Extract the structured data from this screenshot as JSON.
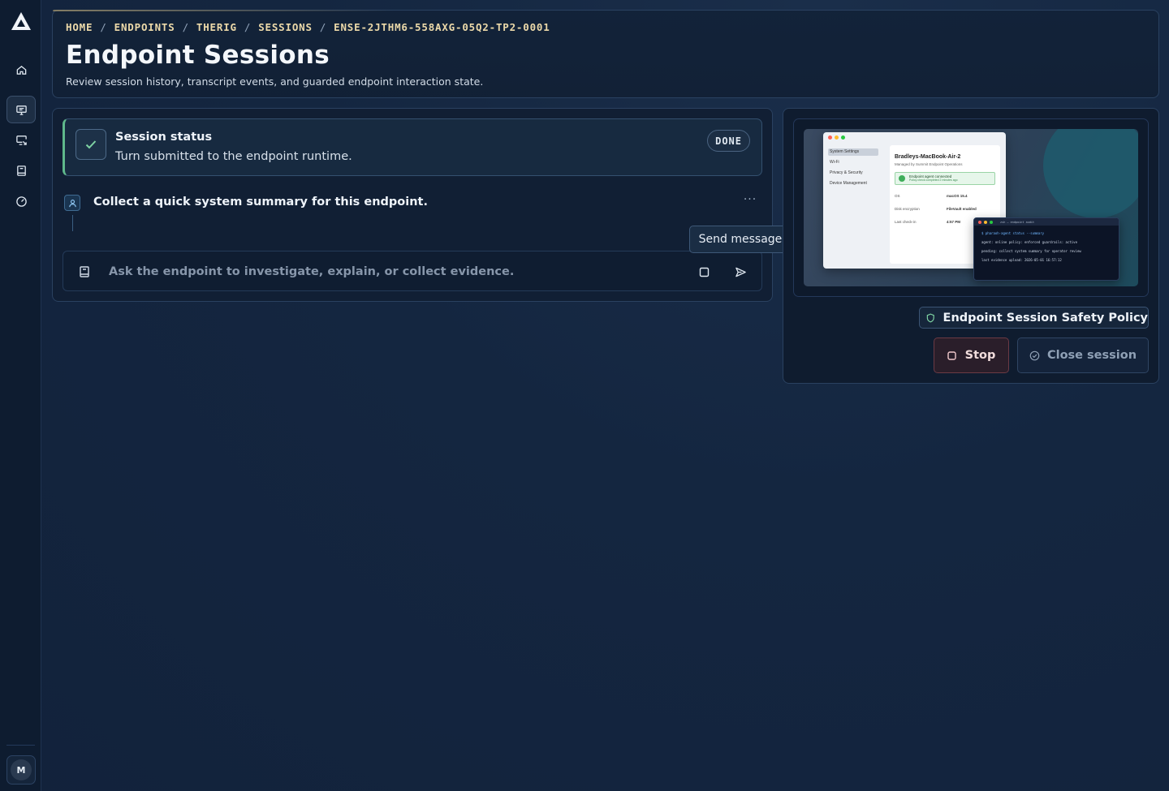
{
  "sidebar": {
    "logo": "triangle-logo",
    "items": [
      {
        "name": "home",
        "icon": "home-icon"
      },
      {
        "name": "endpoints",
        "icon": "monitor-icon",
        "active": true
      },
      {
        "name": "remote",
        "icon": "screen-share-icon"
      },
      {
        "name": "docs",
        "icon": "book-icon"
      },
      {
        "name": "dashboard",
        "icon": "gauge-icon"
      }
    ],
    "user_initial": "M"
  },
  "header": {
    "breadcrumb": [
      "HOME",
      "ENDPOINTS",
      "THERIG",
      "SESSIONS",
      "ENSE-2JTHM6-558AXG-05Q2-TP2-0001"
    ],
    "breadcrumb_separator": "/",
    "title": "Endpoint Sessions",
    "subtitle": "Review session history, transcript events, and guarded endpoint interaction state."
  },
  "status": {
    "title": "Session status",
    "text": "Turn submitted to the endpoint runtime.",
    "badge": "DONE",
    "accent": "#5fb88b"
  },
  "message": {
    "text": "Collect a quick system summary for this endpoint.",
    "more": "···"
  },
  "composer": {
    "placeholder": "Ask the endpoint to investigate, explain, or collect evidence.",
    "value": "",
    "send_tooltip": "Send message"
  },
  "preview": {
    "mac": {
      "sidebar": [
        "System Settings",
        "Wi-Fi",
        "Privacy & Security",
        "Device Management"
      ],
      "host": "Bradleys-MacBook-Air-2",
      "managed_by": "Managed by Summit Endpoint Operations",
      "agent_status": "Endpoint agent connected",
      "agent_detail": "Policy check completed 2 minutes ago",
      "rows": [
        {
          "label": "OS",
          "value": "macOS 15.4"
        },
        {
          "label": "Disk encryption",
          "value": "FileVault enabled"
        },
        {
          "label": "Last check-in",
          "value": "4:57 PM"
        }
      ]
    },
    "terminal": {
      "title": "zsh — endpoint audit",
      "lines": [
        "$ pharaoh-agent status --summary",
        "agent: online policy: enforced guardrails: active",
        "pending: collect system summary for operator review",
        "last evidence upload: 2026-05-01 16:57:12"
      ]
    }
  },
  "actions": {
    "policy_label": "Endpoint Session Safety Policy",
    "stop_label": "Stop",
    "close_label": "Close session"
  }
}
